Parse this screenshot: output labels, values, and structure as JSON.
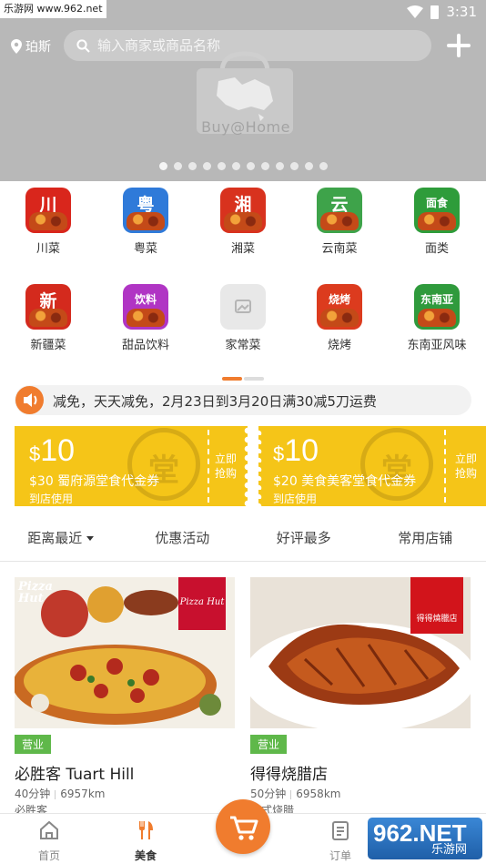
{
  "status_bar": {
    "watermark": "乐游网 www.962.net",
    "time": "3:31"
  },
  "header": {
    "location": "珀斯",
    "search_placeholder": "输入商家或商品名称",
    "banner_logo_text": "Buy@Home",
    "banner_page_count": 12,
    "banner_active_index": 0
  },
  "categories": [
    {
      "label": "川菜",
      "icon_char": "川",
      "icon_color": "#d9261c",
      "icon": "sichuan-cuisine-icon"
    },
    {
      "label": "粤菜",
      "icon_char": "粤",
      "icon_color": "#2f7ad9",
      "icon": "cantonese-cuisine-icon"
    },
    {
      "label": "湘菜",
      "icon_char": "湘",
      "icon_color": "#d8321e",
      "icon": "hunan-cuisine-icon"
    },
    {
      "label": "云南菜",
      "icon_char": "云",
      "icon_color": "#3ea34a",
      "icon": "yunnan-cuisine-icon"
    },
    {
      "label": "面类",
      "icon_char": "面食",
      "icon_color": "#2e9c3a",
      "icon": "noodles-icon"
    },
    {
      "label": "新疆菜",
      "icon_char": "新",
      "icon_color": "#d42a1d",
      "icon": "xinjiang-cuisine-icon"
    },
    {
      "label": "甜品饮料",
      "icon_char": "饮料",
      "icon_color": "#b035c4",
      "icon": "dessert-drinks-icon"
    },
    {
      "label": "家常菜",
      "icon_char": "",
      "icon_color": "#e8e8e8",
      "icon": "image-placeholder-icon"
    },
    {
      "label": "烧烤",
      "icon_char": "烧烤",
      "icon_color": "#dc3b1e",
      "icon": "bbq-icon"
    },
    {
      "label": "东南亚风味",
      "icon_char": "东南亚",
      "icon_color": "#2f9a3c",
      "icon": "southeast-asian-icon"
    }
  ],
  "category_pages": 2,
  "category_active_page": 0,
  "notice": {
    "icon": "speaker-icon",
    "text": "减免，天天减免，2月23日到3月20日满30减5刀运费"
  },
  "coupons": [
    {
      "currency": "$",
      "amount": "10",
      "title": "$30 蜀府源堂食代金券",
      "subtitle": "到店使用",
      "seal": "堂",
      "action": "立即抢购"
    },
    {
      "currency": "$",
      "amount": "10",
      "title": "$20 美食美客堂食代金券",
      "subtitle": "到店使用",
      "seal": "堂",
      "action": "立即抢购"
    }
  ],
  "filters": [
    {
      "label": "距离最近",
      "has_dropdown": true
    },
    {
      "label": "优惠活动"
    },
    {
      "label": "好评最多"
    },
    {
      "label": "常用店铺"
    }
  ],
  "shops": [
    {
      "status": "营业",
      "name": "必胜客 Tuart Hill",
      "time": "40分钟",
      "distance": "6957km",
      "category": "必胜客",
      "logo_text": "Pizza Hut"
    },
    {
      "status": "营业",
      "name": "得得烧腊店",
      "time": "50分钟",
      "distance": "6958km",
      "category": "港式烧腊",
      "logo_text": "得得燒臘店"
    }
  ],
  "bottom_nav": [
    {
      "label": "首页",
      "icon": "home-icon",
      "active": false
    },
    {
      "label": "美食",
      "icon": "utensils-icon",
      "active": true
    },
    {
      "label": "订单",
      "icon": "order-list-icon",
      "active": false
    }
  ],
  "cart": {
    "icon": "cart-icon"
  },
  "watermark_bottom": {
    "brand": "962.NET",
    "text": "乐游网"
  },
  "colors": {
    "accent": "#f07c2e",
    "coupon": "#f5c518",
    "open_badge": "#5fb84a",
    "banner": "#b8b8b8"
  }
}
